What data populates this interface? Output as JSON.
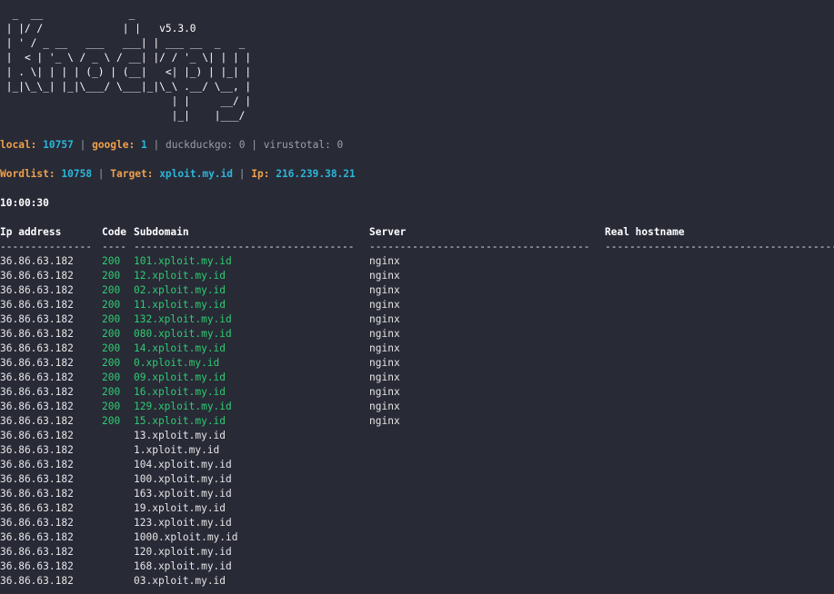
{
  "banner": {
    "lines": [
      "  _  __              _",
      " | |/ /             | |   v5.3.0",
      " | ' / _ __   ___   ___| | ___ __  _   _",
      " |  < | '_ \\ / _ \\ / __| |/ / '_ \\| | | |",
      " | . \\| | | | (_) | (__|   <| |_) | |_| |",
      " |_|\\_\\_| |_|\\___/ \\___|_|\\_\\ .__/ \\__, |",
      "                            | |     __/ |",
      "                            |_|    |___/"
    ]
  },
  "sources": {
    "local_label": "local:",
    "local_value": "10757",
    "sep1": " | ",
    "google_label": "google:",
    "google_value": "1",
    "sep2": " | ",
    "duckduckgo": "duckduckgo: 0",
    "sep3": " | ",
    "virustotal": "virustotal: 0"
  },
  "scan": {
    "wordlist_label": "Wordlist:",
    "wordlist_value": "10758",
    "sep1": " | ",
    "target_label": "Target:",
    "target_value": "xploit.my.id",
    "sep2": " | ",
    "ip_label": "Ip:",
    "ip_value": "216.239.38.21"
  },
  "time": "10:00:30",
  "table": {
    "headers": {
      "ip": "Ip address",
      "code": "Code",
      "subdomain": "Subdomain",
      "server": "Server",
      "real": "Real hostname"
    },
    "dashes": {
      "ip": "---------------",
      "code": "----",
      "subdomain": "------------------------------------",
      "server": "------------------------------------",
      "real": "---------------------------------------"
    },
    "rows": [
      {
        "ip": "36.86.63.182",
        "code": "200",
        "sub": "101.xploit.my.id",
        "server": "nginx"
      },
      {
        "ip": "36.86.63.182",
        "code": "200",
        "sub": "12.xploit.my.id",
        "server": "nginx"
      },
      {
        "ip": "36.86.63.182",
        "code": "200",
        "sub": "02.xploit.my.id",
        "server": "nginx"
      },
      {
        "ip": "36.86.63.182",
        "code": "200",
        "sub": "11.xploit.my.id",
        "server": "nginx"
      },
      {
        "ip": "36.86.63.182",
        "code": "200",
        "sub": "132.xploit.my.id",
        "server": "nginx"
      },
      {
        "ip": "36.86.63.182",
        "code": "200",
        "sub": "080.xploit.my.id",
        "server": "nginx"
      },
      {
        "ip": "36.86.63.182",
        "code": "200",
        "sub": "14.xploit.my.id",
        "server": "nginx"
      },
      {
        "ip": "36.86.63.182",
        "code": "200",
        "sub": "0.xploit.my.id",
        "server": "nginx"
      },
      {
        "ip": "36.86.63.182",
        "code": "200",
        "sub": "09.xploit.my.id",
        "server": "nginx"
      },
      {
        "ip": "36.86.63.182",
        "code": "200",
        "sub": "16.xploit.my.id",
        "server": "nginx"
      },
      {
        "ip": "36.86.63.182",
        "code": "200",
        "sub": "129.xploit.my.id",
        "server": "nginx"
      },
      {
        "ip": "36.86.63.182",
        "code": "200",
        "sub": "15.xploit.my.id",
        "server": "nginx"
      },
      {
        "ip": "36.86.63.182",
        "code": "",
        "sub": "13.xploit.my.id",
        "server": ""
      },
      {
        "ip": "36.86.63.182",
        "code": "",
        "sub": "1.xploit.my.id",
        "server": ""
      },
      {
        "ip": "36.86.63.182",
        "code": "",
        "sub": "104.xploit.my.id",
        "server": ""
      },
      {
        "ip": "36.86.63.182",
        "code": "",
        "sub": "100.xploit.my.id",
        "server": ""
      },
      {
        "ip": "36.86.63.182",
        "code": "",
        "sub": "163.xploit.my.id",
        "server": ""
      },
      {
        "ip": "36.86.63.182",
        "code": "",
        "sub": "19.xploit.my.id",
        "server": ""
      },
      {
        "ip": "36.86.63.182",
        "code": "",
        "sub": "123.xploit.my.id",
        "server": ""
      },
      {
        "ip": "36.86.63.182",
        "code": "",
        "sub": "1000.xploit.my.id",
        "server": ""
      },
      {
        "ip": "36.86.63.182",
        "code": "",
        "sub": "120.xploit.my.id",
        "server": ""
      },
      {
        "ip": "36.86.63.182",
        "code": "",
        "sub": "168.xploit.my.id",
        "server": ""
      },
      {
        "ip": "36.86.63.182",
        "code": "",
        "sub": "03.xploit.my.id",
        "server": ""
      }
    ]
  }
}
